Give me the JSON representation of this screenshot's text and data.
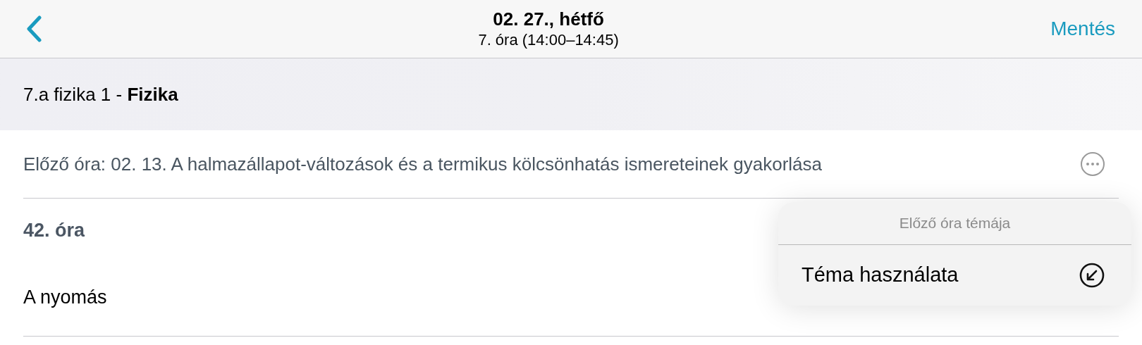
{
  "header": {
    "title": "02. 27., hétfő",
    "subtitle": "7. óra (14:00–14:45)",
    "save": "Mentés"
  },
  "subject": "7.a fizika 1 - **Fizika**",
  "previous": "Előző óra: 02. 13. A halmazállapot-változások és a termikus kölcsönhatás ismereteinek gyakorlása",
  "lesson": {
    "number": "42. óra",
    "topic": "A nyomás"
  },
  "menu": {
    "title": "Előző óra témája",
    "items": [
      {
        "label": "Téma használata"
      }
    ]
  }
}
